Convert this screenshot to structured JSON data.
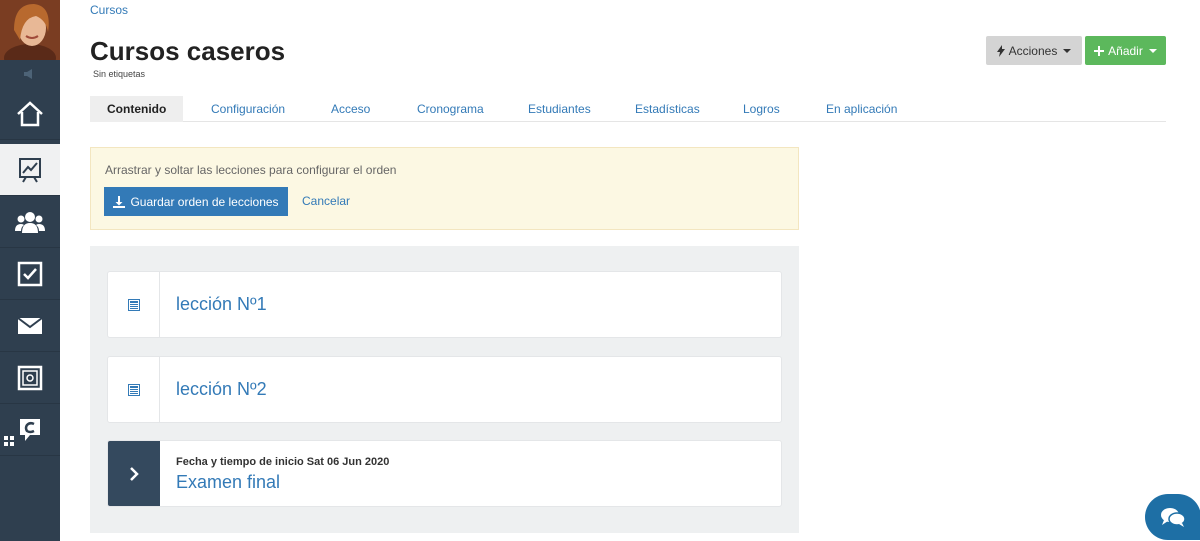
{
  "breadcrumb": {
    "label": "Cursos"
  },
  "page": {
    "title": "Cursos caseros",
    "tags": "Sin etiquetas"
  },
  "header_buttons": {
    "actions_label": "Acciones",
    "add_label": "Añadir"
  },
  "tabs": [
    {
      "label": "Contenido",
      "active": true
    },
    {
      "label": "Configuración"
    },
    {
      "label": "Acceso"
    },
    {
      "label": "Cronograma"
    },
    {
      "label": "Estudiantes"
    },
    {
      "label": "Estadísticas"
    },
    {
      "label": "Logros"
    },
    {
      "label": "En aplicación"
    }
  ],
  "notice": {
    "text": "Arrastrar y soltar las lecciones para configurar el orden",
    "save_label": "Guardar orden de lecciones",
    "cancel_label": "Cancelar"
  },
  "lessons": [
    {
      "title": "lección Nº1",
      "icon": "document-icon"
    },
    {
      "title": "lección Nº2",
      "icon": "document-icon"
    },
    {
      "meta": "Fecha y tiempo de inicio Sat 06 Jun 2020",
      "title": "Examen final",
      "icon": "chevron-right-icon"
    }
  ],
  "sidebar": {
    "items": [
      "home-icon",
      "chart-icon",
      "users-icon",
      "checkbox-icon",
      "mail-icon",
      "safe-icon",
      "chat-logo-icon"
    ],
    "active_item": "chart-icon"
  },
  "colors": {
    "sidebar": "#2f3f4f",
    "link": "#337ab7",
    "add": "#5cb85c",
    "primary": "#337ab7"
  }
}
